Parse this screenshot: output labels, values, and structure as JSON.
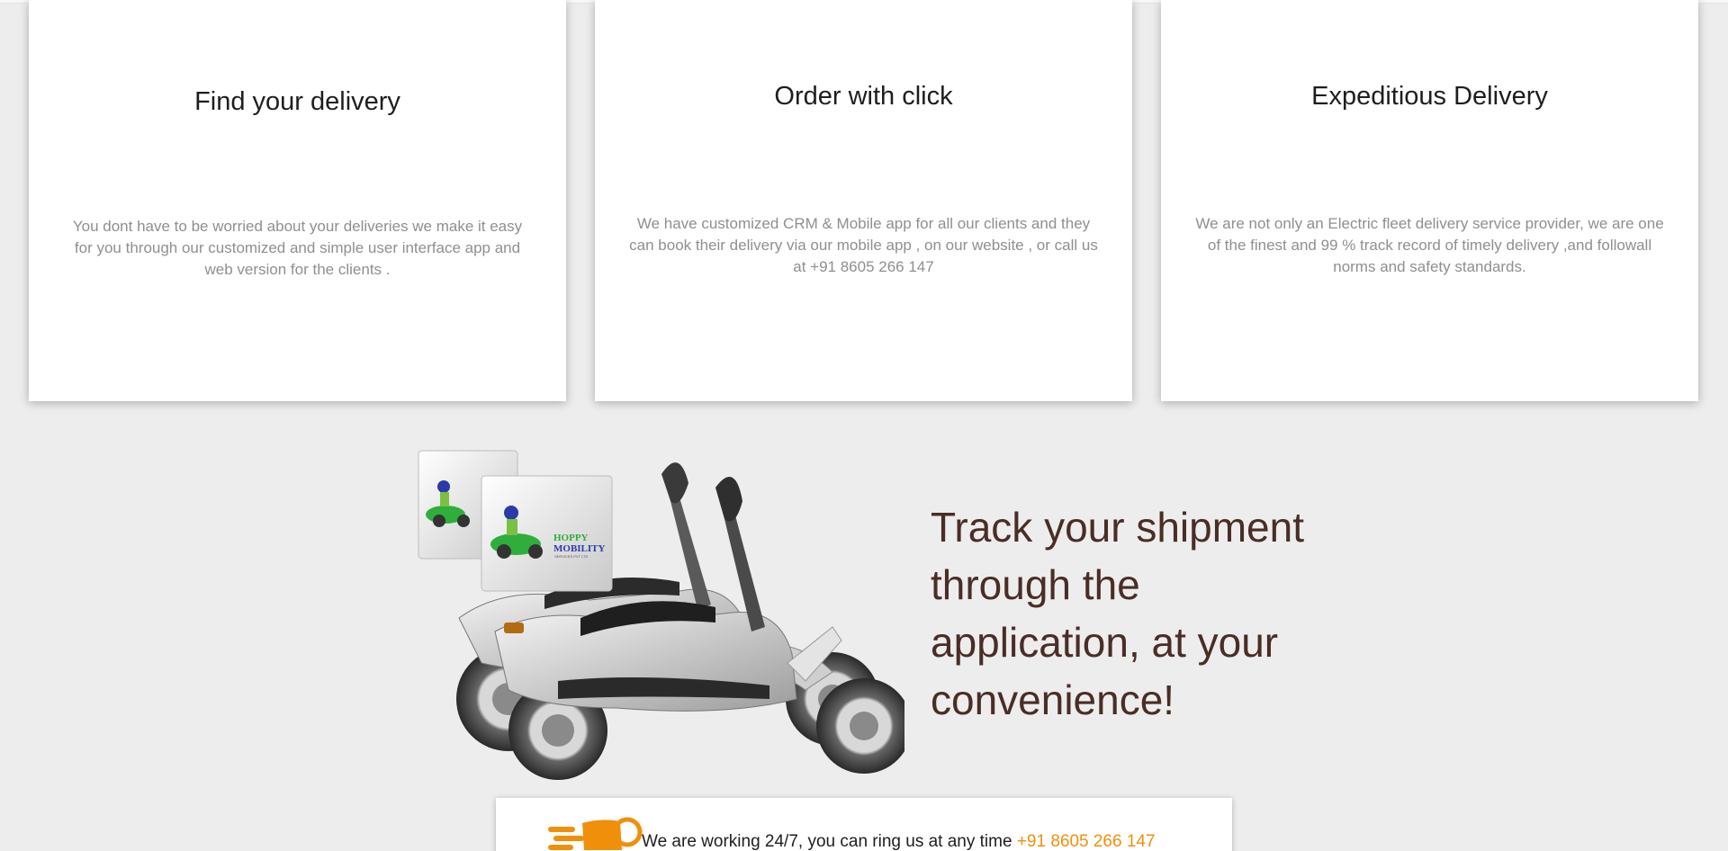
{
  "features": [
    {
      "title": "Find your delivery",
      "description": "You dont have to be worried about your deliveries we make it easy for you through our customized and simple user interface app and web version for the clients ."
    },
    {
      "title": "Order with click",
      "description": "We have customized CRM & Mobile app for all our clients and they can book their delivery via our mobile app , on our website , or call us at +91 8605 266 147"
    },
    {
      "title": "Expeditious Delivery",
      "description": "We are not only an Electric fleet delivery service provider, we are one of the finest and 99 % track record of timely delivery ,and followall norms and safety standards."
    }
  ],
  "promo": {
    "heading": "Track your shipment through the application, at your convenience!",
    "box_brand_line1": "HOPPY",
    "box_brand_line2": "MOBILITY",
    "box_brand_line3": "SERVICES PVT LTD"
  },
  "contact": {
    "text": "We are working 24/7, you can ring us at any time",
    "phone": "+91 8605 266 147"
  },
  "colors": {
    "heading_brown": "#4a2d26",
    "accent_orange": "#f0900a",
    "card_text_gray": "#8f8f8f",
    "background": "#ededed"
  },
  "icons": {
    "scooter_image": "electric-scooter-illustration",
    "contact_icon": "delivery-bike-icon"
  }
}
